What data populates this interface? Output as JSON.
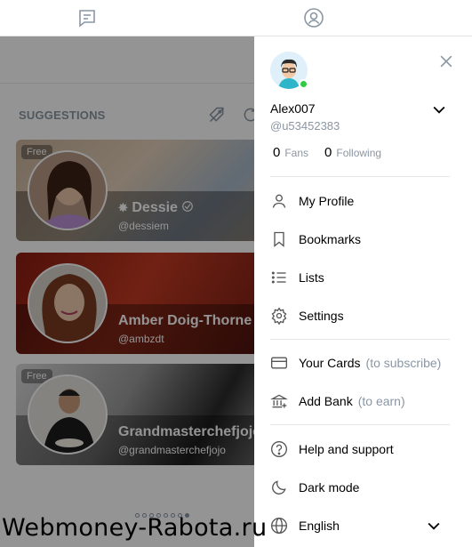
{
  "suggestions": {
    "title": "SUGGESTIONS",
    "cards": [
      {
        "badge": "Free",
        "name": "Dessie",
        "handle": "@dessiem"
      },
      {
        "badge": "",
        "name": "Amber Doig-Thorne",
        "handle": "@ambzdt"
      },
      {
        "badge": "Free",
        "name": "Grandmasterchefjojo",
        "handle": "@grandmasterchefjojo"
      }
    ],
    "pagination_count": 8
  },
  "drawer": {
    "user_name": "Alex007",
    "user_handle": "@u53452383",
    "fans_count": "0",
    "fans_label": "Fans",
    "following_count": "0",
    "following_label": "Following",
    "menu": {
      "my_profile": "My Profile",
      "bookmarks": "Bookmarks",
      "lists": "Lists",
      "settings": "Settings",
      "your_cards": "Your Cards",
      "your_cards_hint": "(to subscribe)",
      "add_bank": "Add Bank",
      "add_bank_hint": "(to earn)",
      "help": "Help and support",
      "dark_mode": "Dark mode",
      "language": "English"
    }
  },
  "watermark": "Webmoney-Rabota.ru",
  "colors": {
    "muted": "#8a96a3",
    "online": "#2ecc40",
    "overlay": "rgba(0,0,0,0.42)"
  }
}
